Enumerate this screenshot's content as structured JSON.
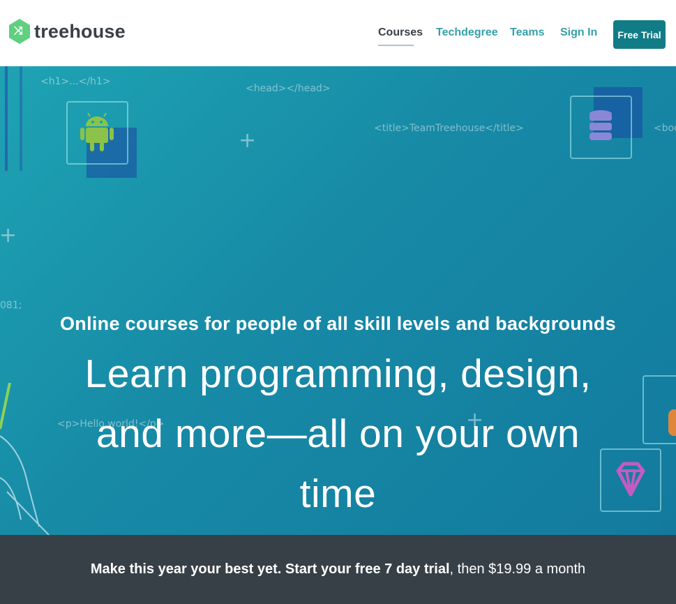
{
  "header": {
    "logo_text": "treehouse",
    "logo_glyph": "⤨",
    "nav": [
      {
        "label": "Courses",
        "active": true
      },
      {
        "label": "Techdegree",
        "active": false
      },
      {
        "label": "Teams",
        "active": false
      },
      {
        "label": "Sign In",
        "active": false
      }
    ],
    "cta_label": "Free Trial"
  },
  "hero": {
    "subtitle": "Online courses for people of all skill levels and backgrounds",
    "headline": "Learn programming, design, and more—all on your own time",
    "code_snippets": {
      "h1": "<h1>...</h1>",
      "head": "<head></head>",
      "title": "<title>TeamTreehouse</title>",
      "body": "<body",
      "entity": "081;",
      "p": "<p>Hello world!</p>"
    },
    "icons": [
      "android-icon",
      "database-icon",
      "gem-icon"
    ]
  },
  "promo": {
    "bold_text": "Make this year your best yet. Start your free 7 day trial",
    "rest_text": ", then $19.99 a month"
  },
  "colors": {
    "brand_green": "#5fcf80",
    "cta_teal": "#127c86",
    "nav_teal": "#35a0a8",
    "hero_start": "#1ea3b3",
    "hero_end": "#137a9e",
    "footer_bg": "#384047"
  }
}
